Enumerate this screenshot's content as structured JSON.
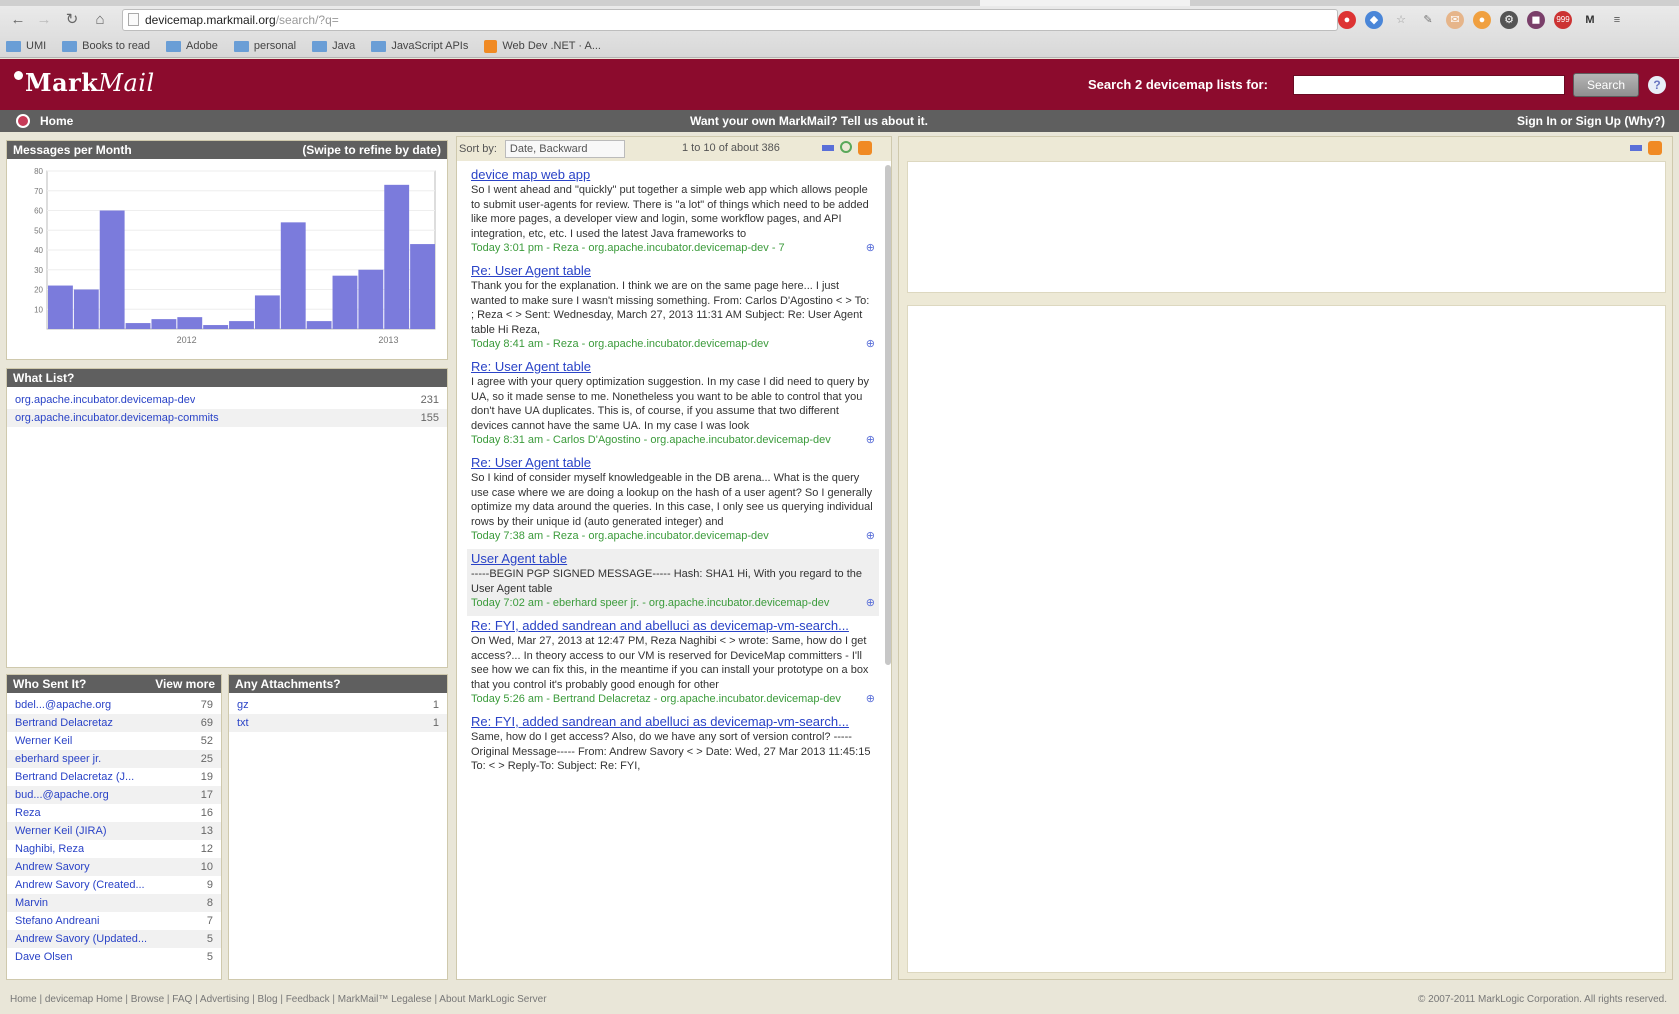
{
  "browser": {
    "url_host": "devicemap.markmail.org",
    "url_path": "/search/?q=",
    "bookmarks": [
      {
        "label": "UMI",
        "type": "folder"
      },
      {
        "label": "Books to read",
        "type": "folder"
      },
      {
        "label": "Adobe",
        "type": "folder"
      },
      {
        "label": "personal",
        "type": "folder"
      },
      {
        "label": "Java",
        "type": "folder"
      },
      {
        "label": "JavaScript APIs",
        "type": "folder"
      },
      {
        "label": "Web Dev .NET · A...",
        "type": "site"
      }
    ],
    "ext_badge": "999"
  },
  "header": {
    "logo_mark": "Mark",
    "logo_mail": "Mail",
    "search_label": "Search 2 devicemap lists for:",
    "search_value": "",
    "search_button": "Search",
    "help": "?"
  },
  "navbar": {
    "home": "Home",
    "promo": "Want your own MarkMail? Tell us about it.",
    "signin": "Sign In or Sign Up (Why?)"
  },
  "messages_panel": {
    "title": "Messages per Month",
    "hint": "(Swipe to refine by date)"
  },
  "chart_data": {
    "type": "bar",
    "title": "Messages per Month",
    "ylim": [
      0,
      80
    ],
    "yticks": [
      10,
      20,
      30,
      40,
      50,
      60,
      70,
      80
    ],
    "xtick_labels": [
      "2012",
      "2013"
    ],
    "values": [
      22,
      20,
      60,
      3,
      5,
      6,
      2,
      4,
      17,
      54,
      4,
      27,
      30,
      73,
      43
    ],
    "bar_color": "#7b7bdc"
  },
  "what_list": {
    "title": "What List?",
    "items": [
      {
        "label": "org.apache.incubator.devicemap-dev",
        "count": "231"
      },
      {
        "label": "org.apache.incubator.devicemap-commits",
        "count": "155"
      }
    ]
  },
  "who_sent": {
    "title": "Who Sent It?",
    "more": "View more",
    "items": [
      {
        "label": "bdel...@apache.org",
        "count": "79"
      },
      {
        "label": "Bertrand Delacretaz",
        "count": "69"
      },
      {
        "label": "Werner Keil",
        "count": "52"
      },
      {
        "label": "eberhard speer jr.",
        "count": "25"
      },
      {
        "label": "Bertrand Delacretaz (J...",
        "count": "19"
      },
      {
        "label": "bud...@apache.org",
        "count": "17"
      },
      {
        "label": "Reza",
        "count": "16"
      },
      {
        "label": "Werner Keil (JIRA)",
        "count": "13"
      },
      {
        "label": "Naghibi, Reza",
        "count": "12"
      },
      {
        "label": "Andrew Savory",
        "count": "10"
      },
      {
        "label": "Andrew Savory (Created...",
        "count": "9"
      },
      {
        "label": "Marvin",
        "count": "8"
      },
      {
        "label": "Stefano Andreani",
        "count": "7"
      },
      {
        "label": "Andrew Savory (Updated...",
        "count": "5"
      },
      {
        "label": "Dave Olsen",
        "count": "5"
      }
    ]
  },
  "attachments": {
    "title": "Any Attachments?",
    "items": [
      {
        "label": "gz",
        "count": "1"
      },
      {
        "label": "txt",
        "count": "1"
      }
    ]
  },
  "results_bar": {
    "sort_label": "Sort by:",
    "sort_value": "Date, Backward",
    "range": "1 to 10 of about 386"
  },
  "results": [
    {
      "title": "device map web app",
      "snippet": "So I went ahead and \"quickly\" put together a simple web app which allows people to submit user-agents for review. There is \"a lot\" of things which need to be added like more pages, a developer view and login, some workflow pages, and API integration, etc, etc. I used the latest Java frameworks to",
      "meta": "Today 3:01 pm - Reza - org.apache.incubator.devicemap-dev - 7"
    },
    {
      "title": "Re: User Agent table",
      "snippet": "Thank you for the explanation. I think we are on the same page here... I just wanted to make sure I wasn't missing something. From: Carlos D'Agostino < > To: ; Reza < > Sent: Wednesday, March 27, 2013 11:31 AM Subject: Re: User Agent table Hi Reza,",
      "meta": "Today 8:41 am - Reza - org.apache.incubator.devicemap-dev"
    },
    {
      "title": "Re: User Agent table",
      "snippet": "I agree with your query optimization suggestion. In my case I did need to query by UA, so it made sense to me. Nonetheless you want to be able to control that you don't have UA duplicates. This is, of course, if you assume that two different devices cannot have the same UA. In my case I was look",
      "meta": "Today 8:31 am - Carlos D'Agostino - org.apache.incubator.devicemap-dev"
    },
    {
      "title": "Re: User Agent table",
      "snippet": "So I kind of consider myself knowledgeable in the DB arena... What is the query use case where we are doing a lookup on the hash of a user agent? So I generally optimize my data around the queries. In this case, I only see us querying individual rows by their unique id (auto generated integer) and",
      "meta": "Today 7:38 am - Reza - org.apache.incubator.devicemap-dev"
    },
    {
      "title": "User Agent table",
      "snippet": "-----BEGIN PGP SIGNED MESSAGE----- Hash: SHA1 Hi, With you regard to the User Agent table",
      "meta": "Today 7:02 am - eberhard speer jr. - org.apache.incubator.devicemap-dev",
      "highlight": true
    },
    {
      "title": "Re: FYI, added sandrean and abelluci as devicemap-vm-search...",
      "snippet": "On Wed, Mar 27, 2013 at 12:47 PM, Reza Naghibi < > wrote: Same, how do I get access?... In theory access to our VM is reserved for DeviceMap committers - I'll see how we can fix this, in the meantime if you can install your prototype on a box that you control it's probably good enough for other",
      "meta": "Today 5:26 am - Bertrand Delacretaz - org.apache.incubator.devicemap-dev"
    },
    {
      "title": "Re: FYI, added sandrean and abelluci as devicemap-vm-search...",
      "snippet": "Same, how do I get access? Also, do we have any sort of version control? -----Original Message----- From: Andrew Savory < > Date: Wed, 27 Mar 2013 11:45:15 To: < > Reply-To: Subject: Re: FYI,",
      "meta": ""
    }
  ],
  "footer": {
    "links": "Home | devicemap Home | Browse | FAQ | Advertising | Blog | Feedback | MarkMail™ Legalese | About MarkLogic Server",
    "copyright": "© 2007-2011 MarkLogic Corporation. All rights reserved."
  }
}
